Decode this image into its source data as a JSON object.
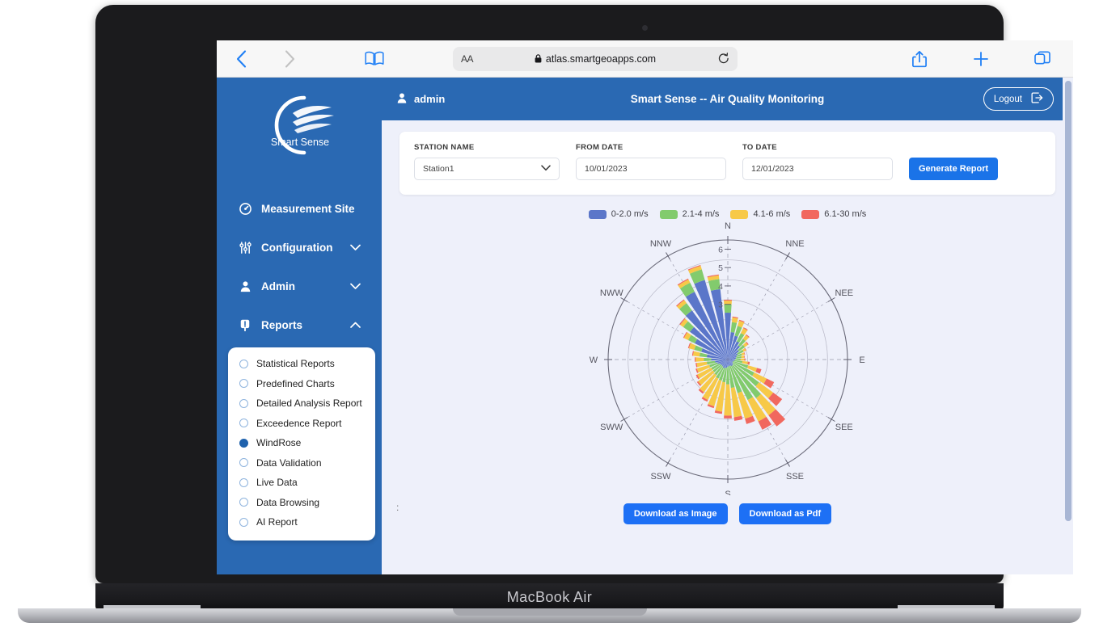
{
  "device": {
    "label": "MacBook Air"
  },
  "browser": {
    "back_icon": "chevron-left-icon",
    "forward_icon": "chevron-right-icon",
    "reader_icon": "book-icon",
    "aa_label": "AA",
    "lock_icon": "lock-icon",
    "url": "atlas.smartgeoapps.com",
    "reload_icon": "reload-icon",
    "share_icon": "share-icon",
    "new_tab_icon": "plus-icon",
    "tabs_icon": "tabs-icon"
  },
  "sidebar": {
    "logo_text": "Smart Sense",
    "items": [
      {
        "label": "Measurement Site",
        "icon": "gauge-icon",
        "expandable": false,
        "expanded": false
      },
      {
        "label": "Configuration",
        "icon": "sliders-icon",
        "expandable": true,
        "expanded": false
      },
      {
        "label": "Admin",
        "icon": "user-icon",
        "expandable": true,
        "expanded": false
      },
      {
        "label": "Reports",
        "icon": "report-icon",
        "expandable": true,
        "expanded": true
      }
    ],
    "reports_submenu": [
      {
        "label": "Statistical Reports",
        "selected": false
      },
      {
        "label": "Predefined Charts",
        "selected": false
      },
      {
        "label": "Detailed Analysis Report",
        "selected": false
      },
      {
        "label": "Exceedence Report",
        "selected": false
      },
      {
        "label": "WindRose",
        "selected": true
      },
      {
        "label": "Data Validation",
        "selected": false
      },
      {
        "label": "Live Data",
        "selected": false
      },
      {
        "label": "Data Browsing",
        "selected": false
      },
      {
        "label": "AI Report",
        "selected": false
      }
    ]
  },
  "topbar": {
    "user_icon": "user-avatar-icon",
    "username": "admin",
    "title": "Smart Sense -- Air Quality Monitoring",
    "logout_label": "Logout",
    "logout_icon": "logout-icon"
  },
  "filters": {
    "station_label": "STATION NAME",
    "station_value": "Station1",
    "station_caret": "chevron-down-icon",
    "from_label": "FROM DATE",
    "from_value": "10/01/2023",
    "to_label": "TO DATE",
    "to_value": "12/01/2023",
    "generate_label": "Generate Report"
  },
  "actions": {
    "download_image": "Download as Image",
    "download_pdf": "Download as Pdf"
  },
  "ellipsis": ":",
  "colors": {
    "sidebar_blue": "#2a69b3",
    "accent_blue": "#1a73e8",
    "button_blue": "#1d70f5",
    "page_bg": "#eef0fa",
    "bin1": "#5b76c9",
    "bin2": "#82cb6d",
    "bin3": "#f7c948",
    "bin4": "#f1685e"
  },
  "chart_data": {
    "type": "bar",
    "subtype": "wind-rose",
    "title": "",
    "xlabel": "",
    "ylabel": "",
    "rlim": [
      0,
      6.5
    ],
    "r_ticks": [
      3,
      4,
      5,
      6
    ],
    "grid": true,
    "legend_position": "top-center",
    "compass_labels": [
      "N",
      "NNE",
      "NEE",
      "E",
      "SEE",
      "SSE",
      "S",
      "SSW",
      "SWW",
      "W",
      "NWW",
      "NNW"
    ],
    "legend": [
      {
        "name": "0-2.0 m/s",
        "color": "#5b76c9"
      },
      {
        "name": "2.1-4 m/s",
        "color": "#82cb6d"
      },
      {
        "name": "4.1-6 m/s",
        "color": "#f7c948"
      },
      {
        "name": "6.1-30 m/s",
        "color": "#f1685e"
      }
    ],
    "sector_count": 36,
    "sector_width_deg": 10,
    "directions_deg": [
      0,
      10,
      20,
      30,
      40,
      50,
      60,
      70,
      80,
      90,
      100,
      110,
      120,
      130,
      140,
      150,
      160,
      170,
      180,
      190,
      200,
      210,
      220,
      230,
      240,
      250,
      260,
      270,
      280,
      290,
      300,
      310,
      320,
      330,
      340,
      350
    ],
    "series": [
      {
        "name": "0-2.0 m/s",
        "color": "#5b76c9",
        "values": [
          2.55,
          1.5,
          1.35,
          1.1,
          0.95,
          0.75,
          0.6,
          0.5,
          0.45,
          0.4,
          0.35,
          0.3,
          0.3,
          0.35,
          0.4,
          0.4,
          0.35,
          0.35,
          0.4,
          0.45,
          0.5,
          0.5,
          0.45,
          0.45,
          0.5,
          0.6,
          0.7,
          0.9,
          1.15,
          1.5,
          2.0,
          2.55,
          3.3,
          4.1,
          4.5,
          3.85
        ]
      },
      {
        "name": "2.1-4 m/s",
        "color": "#82cb6d",
        "values": [
          0.45,
          0.55,
          0.55,
          0.5,
          0.45,
          0.4,
          0.35,
          0.3,
          0.3,
          0.3,
          0.45,
          0.85,
          1.3,
          1.75,
          2.2,
          2.05,
          1.55,
          1.2,
          0.95,
          0.8,
          0.7,
          0.65,
          0.6,
          0.55,
          0.5,
          0.45,
          0.45,
          0.4,
          0.4,
          0.4,
          0.4,
          0.45,
          0.5,
          0.55,
          0.6,
          0.55
        ]
      },
      {
        "name": "4.1-6 m/s",
        "color": "#f7c948",
        "values": [
          0.2,
          0.25,
          0.3,
          0.3,
          0.25,
          0.2,
          0.15,
          0.15,
          0.15,
          0.2,
          0.3,
          0.5,
          0.75,
          0.95,
          1.15,
          1.3,
          1.45,
          1.6,
          1.7,
          1.6,
          1.45,
          1.3,
          1.15,
          1.0,
          0.85,
          0.7,
          0.55,
          0.45,
          0.35,
          0.3,
          0.25,
          0.2,
          0.2,
          0.2,
          0.2,
          0.2
        ]
      },
      {
        "name": "6.1-30 m/s",
        "color": "#f1685e",
        "values": [
          0.05,
          0.05,
          0.05,
          0.05,
          0.05,
          0.05,
          0.03,
          0.03,
          0.03,
          0.05,
          0.1,
          0.25,
          0.45,
          0.6,
          0.75,
          0.5,
          0.3,
          0.2,
          0.15,
          0.12,
          0.1,
          0.1,
          0.1,
          0.08,
          0.08,
          0.07,
          0.06,
          0.05,
          0.05,
          0.05,
          0.05,
          0.05,
          0.05,
          0.05,
          0.05,
          0.05
        ]
      }
    ]
  }
}
